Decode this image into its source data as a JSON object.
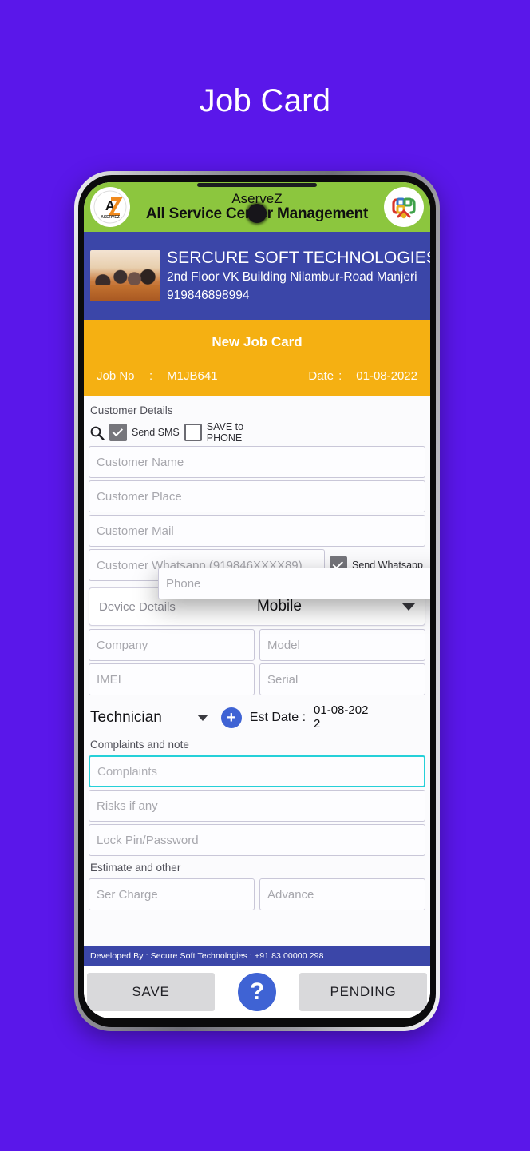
{
  "page": {
    "title": "Job Card",
    "background_color": "#5a17ea"
  },
  "app_header": {
    "app_name": "AserveZ",
    "tagline": "All Service Center Management",
    "left_logo": "aservez-logo-icon",
    "right_logo": "colorful-circle-logo-icon",
    "background_color": "#8cc63e"
  },
  "company_banner": {
    "name": "SERCURE SOFT TECHNOLOGIES",
    "address": "2nd Floor VK Building Nilambur-Road Manjeri",
    "phone": "919846898994",
    "photo": "company-team-photo",
    "background_color": "#3b46a8"
  },
  "jobcard_header": {
    "title": "New Job Card",
    "job_no_label": "Job No",
    "colon": ":",
    "job_no_value": "M1JB641",
    "date_label": "Date",
    "date_value": "01-08-2022",
    "background_color": "#f5b012"
  },
  "customer_section": {
    "label": "Customer Details",
    "phone_placeholder": "Phone",
    "search_icon": "search-icon",
    "send_sms_checked": true,
    "send_sms_label": "Send SMS",
    "save_to_phone_checked": false,
    "save_to_phone_label": "SAVE to\nPHONE",
    "name_placeholder": "Customer Name",
    "place_placeholder": "Customer Place",
    "mail_placeholder": "Customer Mail",
    "whatsapp_placeholder": "Customer Whatsapp (919846XXXX89)",
    "send_whatsapp_checked": true,
    "send_whatsapp_label": "Send Whatsapp"
  },
  "device_section": {
    "select_label": "Device Details",
    "select_value": "Mobile",
    "dropdown_icon": "chevron-down-icon",
    "company_placeholder": "Company",
    "model_placeholder": "Model",
    "imei_placeholder": "IMEI",
    "serial_placeholder": "Serial"
  },
  "technician_section": {
    "technician_value": "Technician",
    "dropdown_icon": "chevron-down-icon",
    "add_icon": "plus-circle-icon",
    "est_date_label": "Est Date :",
    "est_date_value": "01-08-2022"
  },
  "complaints_section": {
    "label": "Complaints and note",
    "complaints_placeholder": "Complaints",
    "risks_placeholder": "Risks if any",
    "lock_placeholder": "Lock Pin/Password",
    "focus_color": "#25d0d8"
  },
  "estimate_section": {
    "label": "Estimate and other",
    "ser_charge_placeholder": "Ser Charge",
    "advance_placeholder": "Advance"
  },
  "footer": {
    "developed_by": "Developed By : Secure Soft Technologies : +91 83 00000 298",
    "save_label": "SAVE",
    "help_icon": "question-mark-icon",
    "help_label": "?",
    "pending_label": "PENDING"
  }
}
